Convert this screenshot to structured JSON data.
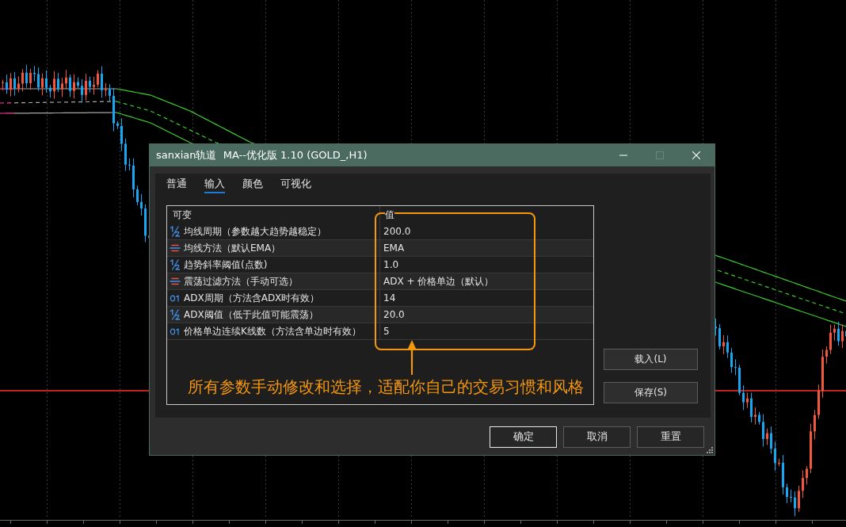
{
  "window": {
    "title": "sanxian轨道  MA--优化版 1.10 (GOLD_,H1)",
    "controls": [
      {
        "kind": "minimize",
        "disabled": false
      },
      {
        "kind": "maximize",
        "disabled": true
      },
      {
        "kind": "close",
        "disabled": false
      }
    ]
  },
  "tabs": [
    {
      "label": "普通",
      "selected": false
    },
    {
      "label": "输入",
      "selected": true
    },
    {
      "label": "颜色",
      "selected": false
    },
    {
      "label": "可视化",
      "selected": false
    }
  ],
  "table": {
    "columns": [
      "可变",
      "值"
    ],
    "rows": [
      {
        "kind": "double",
        "name": "均线周期（参数越大趋势越稳定）",
        "value": "200.0"
      },
      {
        "kind": "enum",
        "name": "均线方法（默认EMA）",
        "value": "EMA"
      },
      {
        "kind": "double",
        "name": "趋势斜率阈值(点数)",
        "value": "1.0"
      },
      {
        "kind": "enum",
        "name": "震荡过滤方法（手动可选）",
        "value": "ADX + 价格单边（默认）"
      },
      {
        "kind": "integer",
        "name": "ADX周期（方法含ADX时有效）",
        "value": "14"
      },
      {
        "kind": "double",
        "name": "ADX阈值（低于此值可能震荡）",
        "value": "20.0"
      },
      {
        "kind": "integer",
        "name": "价格单边连续K线数（方法含单边时有效）",
        "value": "5"
      }
    ]
  },
  "annotation": {
    "text": "所有参数手动修改和选择，适配你自己的交易习惯和风格"
  },
  "side_buttons": [
    {
      "label": "载入(L)"
    },
    {
      "label": "保存(S)"
    }
  ],
  "footer_buttons": [
    {
      "label": "确定",
      "default": true
    },
    {
      "label": "取消",
      "default": false
    },
    {
      "label": "重置",
      "default": false
    }
  ]
}
